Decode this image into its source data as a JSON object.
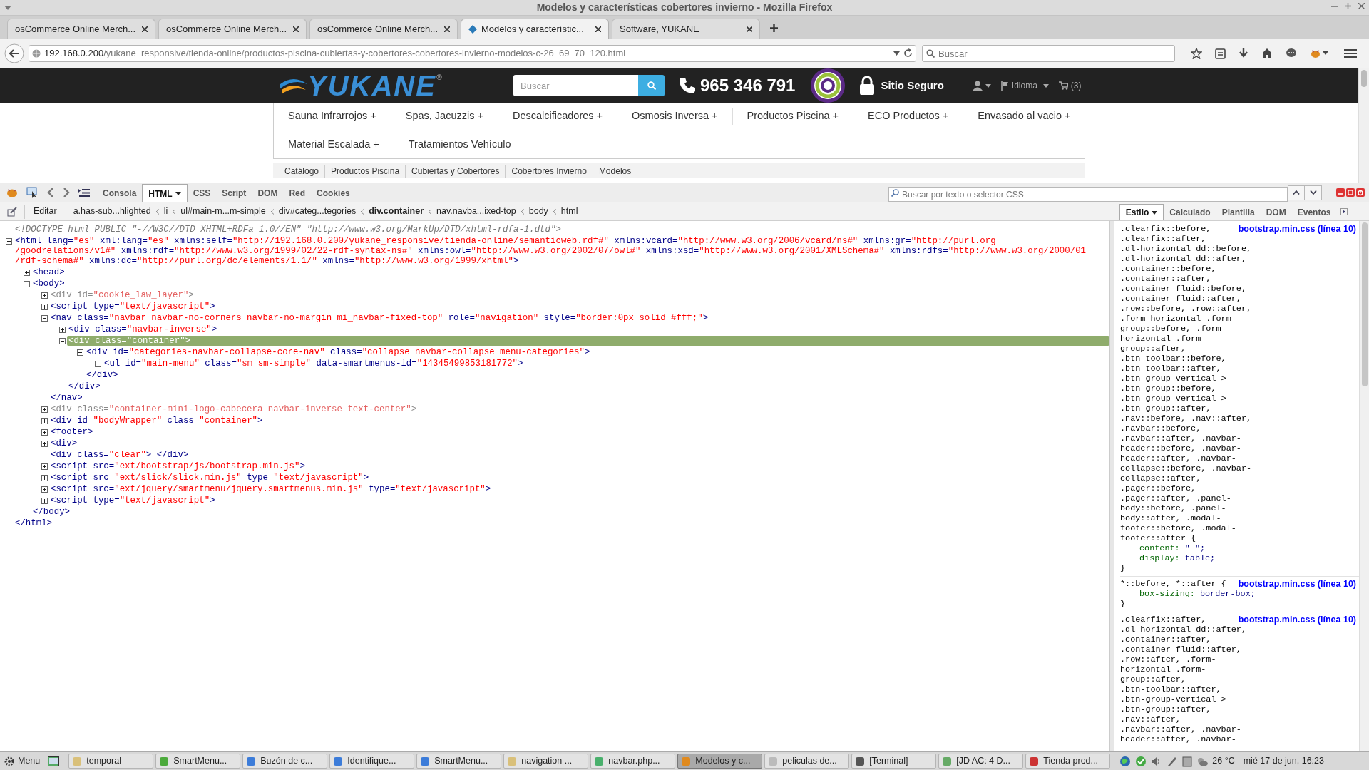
{
  "window": {
    "title": "Modelos y características cobertores invierno - Mozilla Firefox"
  },
  "tabs": [
    {
      "label": "osCommerce Online Merch...",
      "selected": false
    },
    {
      "label": "osCommerce Online Merch...",
      "selected": false
    },
    {
      "label": "osCommerce Online Merch...",
      "selected": false
    },
    {
      "label": "Modelos y característic...",
      "selected": true
    },
    {
      "label": "Software, YUKANE",
      "selected": false
    }
  ],
  "address_bar": {
    "host": "192.168.0.200",
    "path": "/yukane_responsive/tienda-online/productos-piscina-cubiertas-y-cobertores-cobertores-invierno-modelos-c-26_69_70_120.html"
  },
  "search_bar": {
    "placeholder": "Buscar"
  },
  "site": {
    "logo": "YUKANE",
    "logo_mark": "®",
    "search_placeholder": "Buscar",
    "phone": "965 346 791",
    "secure": "Sitio Seguro",
    "language": "Idioma",
    "cart": "(3)",
    "menu_rows": [
      [
        "Sauna Infrarrojos +",
        "Spas, Jacuzzis +",
        "Descalcificadores +",
        "Osmosis Inversa +",
        "Productos Piscina +",
        "ECO Productos +",
        "Envasado al vacio +"
      ],
      [
        "Material Escalada +",
        "Tratamientos Vehículo"
      ]
    ],
    "breadcrumb": [
      "Catálogo",
      "Productos Piscina",
      "Cubiertas y Cobertores",
      "Cobertores Invierno",
      "Modelos"
    ]
  },
  "devtools": {
    "panels": [
      {
        "label": "Consola",
        "selected": false
      },
      {
        "label": "HTML",
        "selected": true
      },
      {
        "label": "CSS",
        "selected": false
      },
      {
        "label": "Script",
        "selected": false
      },
      {
        "label": "DOM",
        "selected": false
      },
      {
        "label": "Red",
        "selected": false
      },
      {
        "label": "Cookies",
        "selected": false
      }
    ],
    "search_placeholder": "Buscar por texto o selector CSS",
    "edit_button": "Editar",
    "path": [
      {
        "label": "a.has-sub...hlighted",
        "selected": false
      },
      {
        "label": "li",
        "selected": false
      },
      {
        "label": "ul#main-m...m-simple",
        "selected": false
      },
      {
        "label": "div#categ...tegories",
        "selected": false
      },
      {
        "label": "div.container",
        "selected": true
      },
      {
        "label": "nav.navba...ixed-top",
        "selected": false
      },
      {
        "label": "body",
        "selected": false
      },
      {
        "label": "html",
        "selected": false
      }
    ],
    "side_tabs": [
      {
        "label": "Estilo",
        "selected": true
      },
      {
        "label": "Calculado",
        "selected": false
      },
      {
        "label": "Plantilla",
        "selected": false
      },
      {
        "label": "DOM",
        "selected": false
      },
      {
        "label": "Eventos",
        "selected": false
      }
    ],
    "tree": [
      {
        "kind": "leaf",
        "lines": [
          [
            {
              "kind": "doctype",
              "text": "<!DOCTYPE html PUBLIC \"-//W3C//DTD XHTML+RDFa 1.0//EN\" \"http://www.w3.org/MarkUp/DTD/xhtml-rdfa-1.dtd\">"
            }
          ]
        ]
      },
      {
        "kind": "element",
        "expanded": true,
        "selected": false,
        "lines": [
          [
            {
              "kind": "markup",
              "text": "<html lang="
            },
            {
              "kind": "value",
              "text": "\"es\""
            },
            {
              "kind": "markup",
              "text": " xml:lang="
            },
            {
              "kind": "value",
              "text": "\"es\""
            },
            {
              "kind": "markup",
              "text": " xmlns:self="
            },
            {
              "kind": "value",
              "text": "\"http://192.168.0.200/yukane_responsive/tienda-online/semanticweb.rdf#\""
            },
            {
              "kind": "markup",
              "text": " xmlns:vcard="
            },
            {
              "kind": "value",
              "text": "\"http://www.w3.org/2006/vcard/ns#\""
            },
            {
              "kind": "markup",
              "text": " xmlns:gr="
            },
            {
              "kind": "value",
              "text": "\"http://purl.org"
            }
          ],
          [
            {
              "kind": "value",
              "text": "/goodrelations/v1#\""
            },
            {
              "kind": "markup",
              "text": " xmlns:rdf="
            },
            {
              "kind": "value",
              "text": "\"http://www.w3.org/1999/02/22-rdf-syntax-ns#\""
            },
            {
              "kind": "markup",
              "text": " xmlns:owl="
            },
            {
              "kind": "value",
              "text": "\"http://www.w3.org/2002/07/owl#\""
            },
            {
              "kind": "markup",
              "text": " xmlns:xsd="
            },
            {
              "kind": "value",
              "text": "\"http://www.w3.org/2001/XMLSchema#\""
            },
            {
              "kind": "markup",
              "text": " xmlns:rdfs="
            },
            {
              "kind": "value",
              "text": "\"http://www.w3.org/2000/01"
            }
          ],
          [
            {
              "kind": "value",
              "text": "/rdf-schema#\""
            },
            {
              "kind": "markup",
              "text": " xmlns:dc="
            },
            {
              "kind": "value",
              "text": "\"http://purl.org/dc/elements/1.1/\""
            },
            {
              "kind": "markup",
              "text": " xmlns="
            },
            {
              "kind": "value",
              "text": "\"http://www.w3.org/1999/xhtml\""
            },
            {
              "kind": "markup",
              "text": ">"
            }
          ]
        ],
        "closing": "</html>",
        "children": [
          {
            "kind": "element",
            "expanded": false,
            "selected": false,
            "lines": [
              [
                {
                  "kind": "markup",
                  "text": "<head>"
                }
              ]
            ]
          },
          {
            "kind": "element",
            "expanded": true,
            "selected": false,
            "lines": [
              [
                {
                  "kind": "markup",
                  "text": "<body>"
                }
              ]
            ],
            "closing": "</body>",
            "children": [
              {
                "kind": "element",
                "expanded": false,
                "selected": false,
                "hidden": true,
                "lines": [
                  [
                    {
                      "kind": "markup",
                      "text": "<div id="
                    },
                    {
                      "kind": "value",
                      "text": "\"cookie_law_layer\""
                    },
                    {
                      "kind": "markup",
                      "text": ">"
                    }
                  ]
                ]
              },
              {
                "kind": "element",
                "expanded": false,
                "selected": false,
                "lines": [
                  [
                    {
                      "kind": "markup",
                      "text": "<script type="
                    },
                    {
                      "kind": "value",
                      "text": "\"text/javascript\""
                    },
                    {
                      "kind": "markup",
                      "text": ">"
                    }
                  ]
                ]
              },
              {
                "kind": "element",
                "expanded": true,
                "selected": false,
                "lines": [
                  [
                    {
                      "kind": "markup",
                      "text": "<nav class="
                    },
                    {
                      "kind": "value",
                      "text": "\"navbar navbar-no-corners navbar-no-margin mi_navbar-fixed-top\""
                    },
                    {
                      "kind": "markup",
                      "text": " role="
                    },
                    {
                      "kind": "value",
                      "text": "\"navigation\""
                    },
                    {
                      "kind": "markup",
                      "text": " style="
                    },
                    {
                      "kind": "value",
                      "text": "\"border:0px solid #fff;\""
                    },
                    {
                      "kind": "markup",
                      "text": ">"
                    }
                  ]
                ],
                "closing": "</nav>",
                "children": [
                  {
                    "kind": "element",
                    "expanded": false,
                    "selected": false,
                    "lines": [
                      [
                        {
                          "kind": "markup",
                          "text": "<div class="
                        },
                        {
                          "kind": "value",
                          "text": "\"navbar-inverse\""
                        },
                        {
                          "kind": "markup",
                          "text": ">"
                        }
                      ]
                    ]
                  },
                  {
                    "kind": "element",
                    "expanded": true,
                    "selected": true,
                    "lines": [
                      [
                        {
                          "kind": "markup",
                          "text": "<div class="
                        },
                        {
                          "kind": "value",
                          "text": "\"container\""
                        },
                        {
                          "kind": "markup",
                          "text": ">"
                        }
                      ]
                    ],
                    "closing": "</div>",
                    "children": [
                      {
                        "kind": "element",
                        "expanded": true,
                        "selected": false,
                        "lines": [
                          [
                            {
                              "kind": "markup",
                              "text": "<div id="
                            },
                            {
                              "kind": "value",
                              "text": "\"categories-navbar-collapse-core-nav\""
                            },
                            {
                              "kind": "markup",
                              "text": " class="
                            },
                            {
                              "kind": "value",
                              "text": "\"collapse navbar-collapse menu-categories\""
                            },
                            {
                              "kind": "markup",
                              "text": ">"
                            }
                          ]
                        ],
                        "closing": "</div>",
                        "children": [
                          {
                            "kind": "element",
                            "expanded": false,
                            "selected": false,
                            "lines": [
                              [
                                {
                                  "kind": "markup",
                                  "text": "<ul id="
                                },
                                {
                                  "kind": "value",
                                  "text": "\"main-menu\""
                                },
                                {
                                  "kind": "markup",
                                  "text": " class="
                                },
                                {
                                  "kind": "value",
                                  "text": "\"sm sm-simple\""
                                },
                                {
                                  "kind": "markup",
                                  "text": " data-smartmenus-id="
                                },
                                {
                                  "kind": "value",
                                  "text": "\"14345499853181772\""
                                },
                                {
                                  "kind": "markup",
                                  "text": ">"
                                }
                              ]
                            ]
                          }
                        ]
                      }
                    ]
                  }
                ]
              },
              {
                "kind": "element",
                "expanded": false,
                "selected": false,
                "hidden": true,
                "lines": [
                  [
                    {
                      "kind": "markup",
                      "text": "<div class="
                    },
                    {
                      "kind": "value",
                      "text": "\"container-mini-logo-cabecera navbar-inverse text-center\""
                    },
                    {
                      "kind": "markup",
                      "text": ">"
                    }
                  ]
                ]
              },
              {
                "kind": "element",
                "expanded": false,
                "selected": false,
                "lines": [
                  [
                    {
                      "kind": "markup",
                      "text": "<div id="
                    },
                    {
                      "kind": "value",
                      "text": "\"bodyWrapper\""
                    },
                    {
                      "kind": "markup",
                      "text": " class="
                    },
                    {
                      "kind": "value",
                      "text": "\"container\""
                    },
                    {
                      "kind": "markup",
                      "text": ">"
                    }
                  ]
                ]
              },
              {
                "kind": "element",
                "expanded": false,
                "selected": false,
                "lines": [
                  [
                    {
                      "kind": "markup",
                      "text": "<footer>"
                    }
                  ]
                ]
              },
              {
                "kind": "element",
                "expanded": false,
                "selected": false,
                "lines": [
                  [
                    {
                      "kind": "markup",
                      "text": "<div>"
                    }
                  ]
                ]
              },
              {
                "kind": "leaf",
                "lines": [
                  [
                    {
                      "kind": "markup",
                      "text": "<div class="
                    },
                    {
                      "kind": "value",
                      "text": "\"clear\""
                    },
                    {
                      "kind": "markup",
                      "text": "> </div>"
                    }
                  ]
                ]
              },
              {
                "kind": "element",
                "expanded": false,
                "selected": false,
                "lines": [
                  [
                    {
                      "kind": "markup",
                      "text": "<script src="
                    },
                    {
                      "kind": "value",
                      "text": "\"ext/bootstrap/js/bootstrap.min.js\""
                    },
                    {
                      "kind": "markup",
                      "text": ">"
                    }
                  ]
                ]
              },
              {
                "kind": "element",
                "expanded": false,
                "selected": false,
                "lines": [
                  [
                    {
                      "kind": "markup",
                      "text": "<script src="
                    },
                    {
                      "kind": "value",
                      "text": "\"ext/slick/slick.min.js\""
                    },
                    {
                      "kind": "markup",
                      "text": " type="
                    },
                    {
                      "kind": "value",
                      "text": "\"text/javascript\""
                    },
                    {
                      "kind": "markup",
                      "text": ">"
                    }
                  ]
                ]
              },
              {
                "kind": "element",
                "expanded": false,
                "selected": false,
                "lines": [
                  [
                    {
                      "kind": "markup",
                      "text": "<script src="
                    },
                    {
                      "kind": "value",
                      "text": "\"ext/jquery/smartmenu/jquery.smartmenus.min.js\""
                    },
                    {
                      "kind": "markup",
                      "text": " type="
                    },
                    {
                      "kind": "value",
                      "text": "\"text/javascript\""
                    },
                    {
                      "kind": "markup",
                      "text": ">"
                    }
                  ]
                ]
              },
              {
                "kind": "element",
                "expanded": false,
                "selected": false,
                "lines": [
                  [
                    {
                      "kind": "markup",
                      "text": "<script type="
                    },
                    {
                      "kind": "value",
                      "text": "\"text/javascript\""
                    },
                    {
                      "kind": "markup",
                      "text": ">"
                    }
                  ]
                ]
              }
            ]
          }
        ]
      }
    ],
    "rules": [
      {
        "selector_lines": [
          ".clearfix::before,",
          ".clearfix::after,",
          ".dl-horizontal dd::before,",
          ".dl-horizontal dd::after,",
          ".container::before,",
          ".container::after,",
          ".container-fluid::before,",
          ".container-fluid::after,",
          ".row::before, .row::after,",
          ".form-horizontal .form-",
          "group::before, .form-",
          "horizontal .form-",
          "group::after,",
          ".btn-toolbar::before,",
          ".btn-toolbar::after,",
          ".btn-group-vertical >",
          ".btn-group::before,",
          ".btn-group-vertical >",
          ".btn-group::after,",
          ".nav::before, .nav::after,",
          ".navbar::before,",
          ".navbar::after, .navbar-",
          "header::before, .navbar-",
          "header::after, .navbar-",
          "collapse::before, .navbar-",
          "collapse::after,",
          ".pager::before,",
          ".pager::after, .panel-",
          "body::before, .panel-",
          "body::after, .modal-",
          "footer::before, .modal-",
          "footer::after {"
        ],
        "source": "bootstrap.min.css (línea 10)",
        "declarations": [
          {
            "property": "content:",
            "value": "\" \";"
          },
          {
            "property": "display:",
            "value": "table;"
          }
        ],
        "close": "}"
      },
      {
        "selector_lines": [
          "*::before, *::after {"
        ],
        "source": "bootstrap.min.css (línea 10)",
        "declarations": [
          {
            "property": "box-sizing:",
            "value": "border-box;"
          }
        ],
        "close": "}"
      },
      {
        "selector_lines": [
          ".clearfix::after,",
          ".dl-horizontal dd::after,",
          ".container::after,",
          ".container-fluid::after,",
          ".row::after, .form-",
          "horizontal .form-",
          "group::after,",
          ".btn-toolbar::after,",
          ".btn-group-vertical >",
          ".btn-group::after,",
          ".nav::after,",
          ".navbar::after, .navbar-",
          "header::after, .navbar-"
        ],
        "source": "bootstrap.min.css (línea 10)"
      }
    ]
  },
  "taskbar": {
    "menu": "Menu",
    "items": [
      {
        "label": "temporal",
        "selected": false
      },
      {
        "label": "SmartMenu...",
        "selected": false
      },
      {
        "label": "Buzón de c...",
        "selected": false
      },
      {
        "label": "Identifique...",
        "selected": false
      },
      {
        "label": "SmartMenu...",
        "selected": false
      },
      {
        "label": "navigation ...",
        "selected": false
      },
      {
        "label": "navbar.php...",
        "selected": false
      },
      {
        "label": "Modelos y c...",
        "selected": true
      },
      {
        "label": "peliculas de...",
        "selected": false
      },
      {
        "label": "[Terminal]",
        "selected": false
      },
      {
        "label": "[JD AC: 4 D...",
        "selected": false
      },
      {
        "label": "Tienda prod...",
        "selected": false
      }
    ],
    "temperature": "26 °C",
    "clock": "mié 17 de jun, 16:23"
  }
}
